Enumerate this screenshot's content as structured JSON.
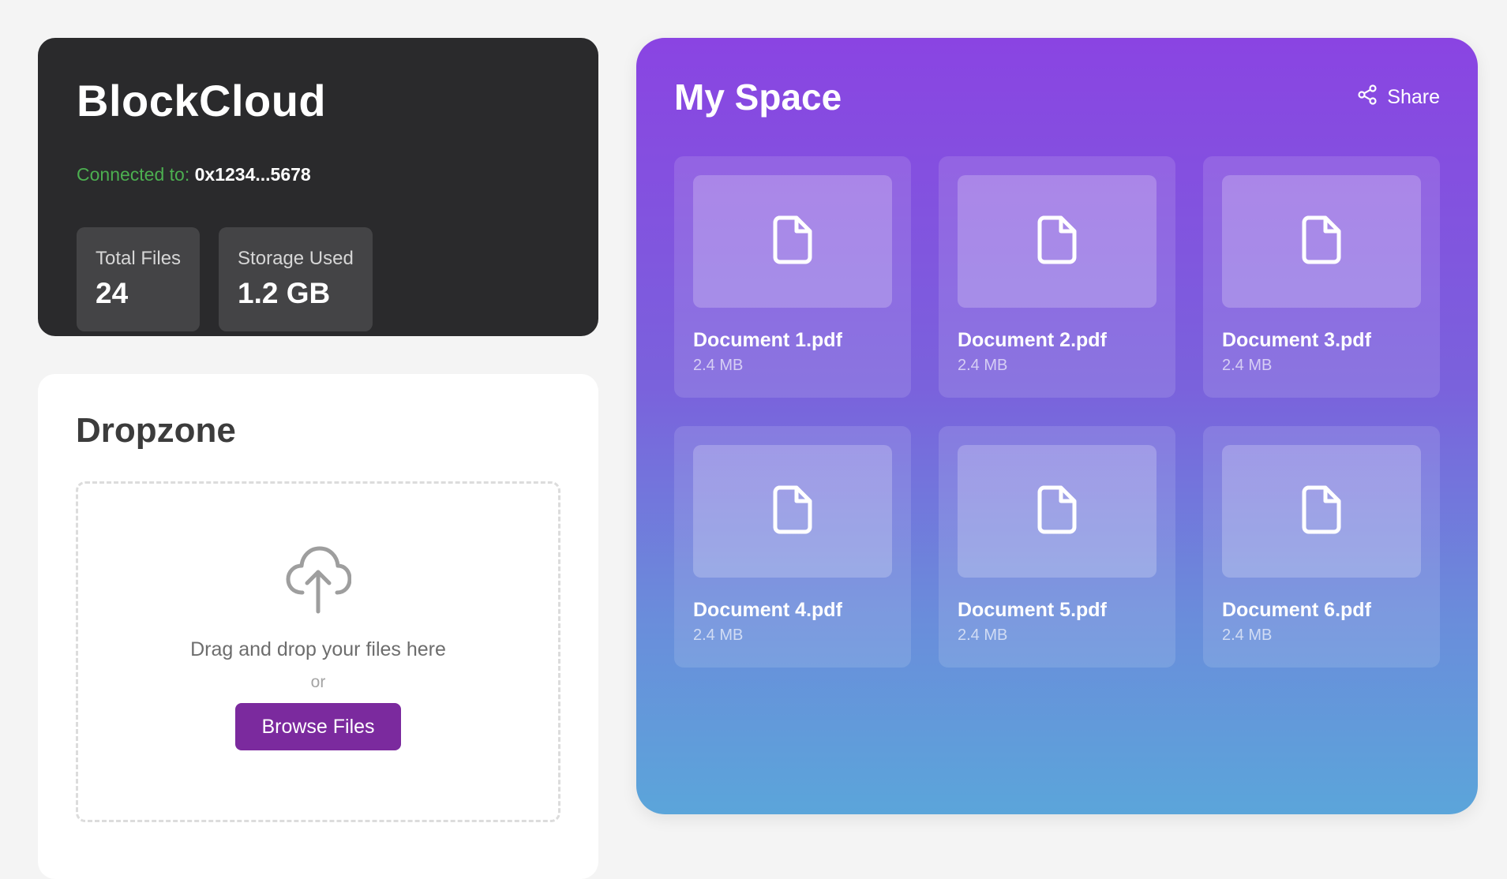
{
  "wallet": {
    "app_title": "BlockCloud",
    "connection_label": "Connected to:",
    "connection_address": "0x1234...5678",
    "stats": [
      {
        "label": "Total Files",
        "value": "24"
      },
      {
        "label": "Storage Used",
        "value": "1.2 GB"
      }
    ]
  },
  "dropzone": {
    "title": "Dropzone",
    "icon": "cloud-upload-icon",
    "drop_text": "Drag and drop your files here",
    "or_text": "or",
    "browse_label": "Browse Files"
  },
  "space": {
    "title": "My Space",
    "share_label": "Share",
    "share_icon": "share-icon",
    "files": [
      {
        "name": "Document 1.pdf",
        "size": "2.4 MB",
        "icon": "file-icon"
      },
      {
        "name": "Document 2.pdf",
        "size": "2.4 MB",
        "icon": "file-icon"
      },
      {
        "name": "Document 3.pdf",
        "size": "2.4 MB",
        "icon": "file-icon"
      },
      {
        "name": "Document 4.pdf",
        "size": "2.4 MB",
        "icon": "file-icon"
      },
      {
        "name": "Document 5.pdf",
        "size": "2.4 MB",
        "icon": "file-icon"
      },
      {
        "name": "Document 6.pdf",
        "size": "2.4 MB",
        "icon": "file-icon"
      }
    ]
  },
  "colors": {
    "page_background": "#f4f4f4",
    "wallet_card": "#2a2a2c",
    "connected_label": "#4caf50",
    "browse_button": "#7b2a9e",
    "space_gradient_top": "#8a44e2",
    "space_gradient_bottom": "#5ba5da"
  }
}
